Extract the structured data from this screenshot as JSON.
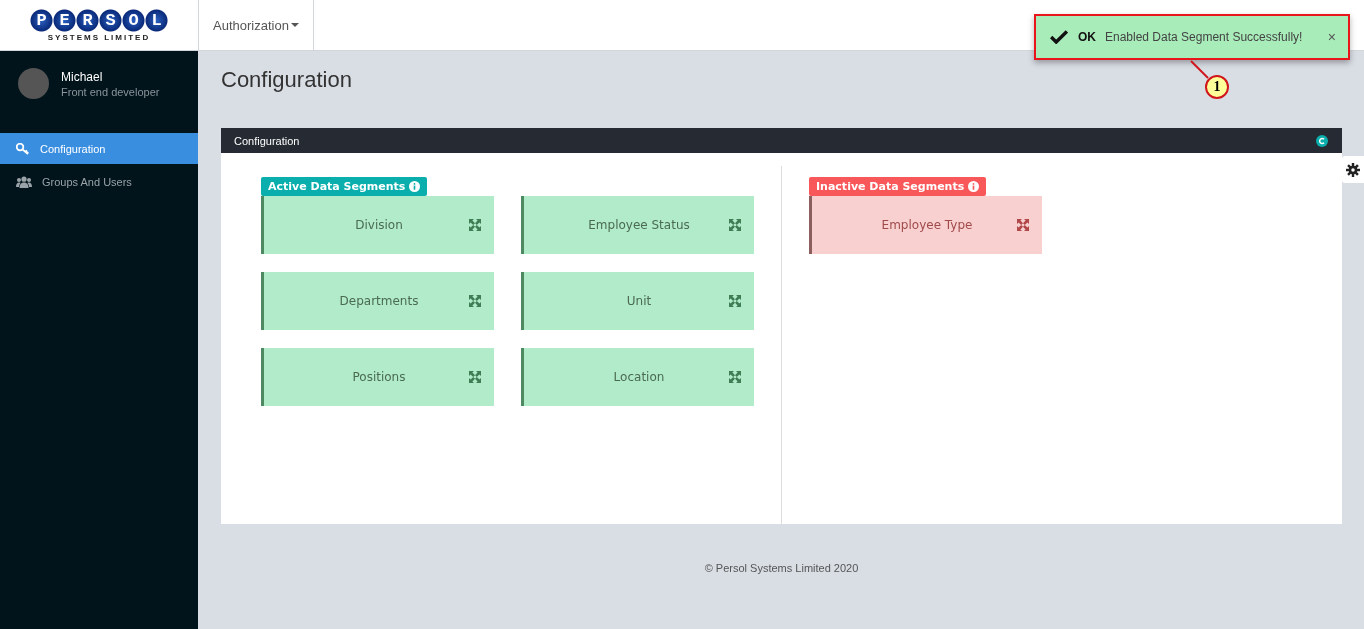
{
  "header": {
    "logo": {
      "letters": "PERSOL",
      "subtitle": "SYSTEMS LIMITED"
    },
    "menu": {
      "label": "Authorization"
    }
  },
  "sidebar": {
    "user": {
      "name": "Michael",
      "role": "Front end developer"
    },
    "items": [
      {
        "label": "Configuration",
        "selected": true
      },
      {
        "label": "Groups And Users",
        "selected": false
      }
    ]
  },
  "page_title": "Configuration",
  "panel": {
    "title": "Configuration",
    "groups": [
      {
        "kind": "active",
        "label": "Active Data Segments",
        "items": [
          "Division",
          "Employee Status",
          "Departments",
          "Unit",
          "Positions",
          "Location"
        ]
      },
      {
        "kind": "inactive",
        "label": "Inactive Data Segments",
        "items": [
          "Employee Type"
        ]
      }
    ]
  },
  "footer": "© Persol Systems Limited 2020",
  "toast": {
    "title": "OK",
    "message": "Enabled Data Segment Successfully!",
    "close": "×"
  },
  "callout": {
    "label": "1"
  }
}
